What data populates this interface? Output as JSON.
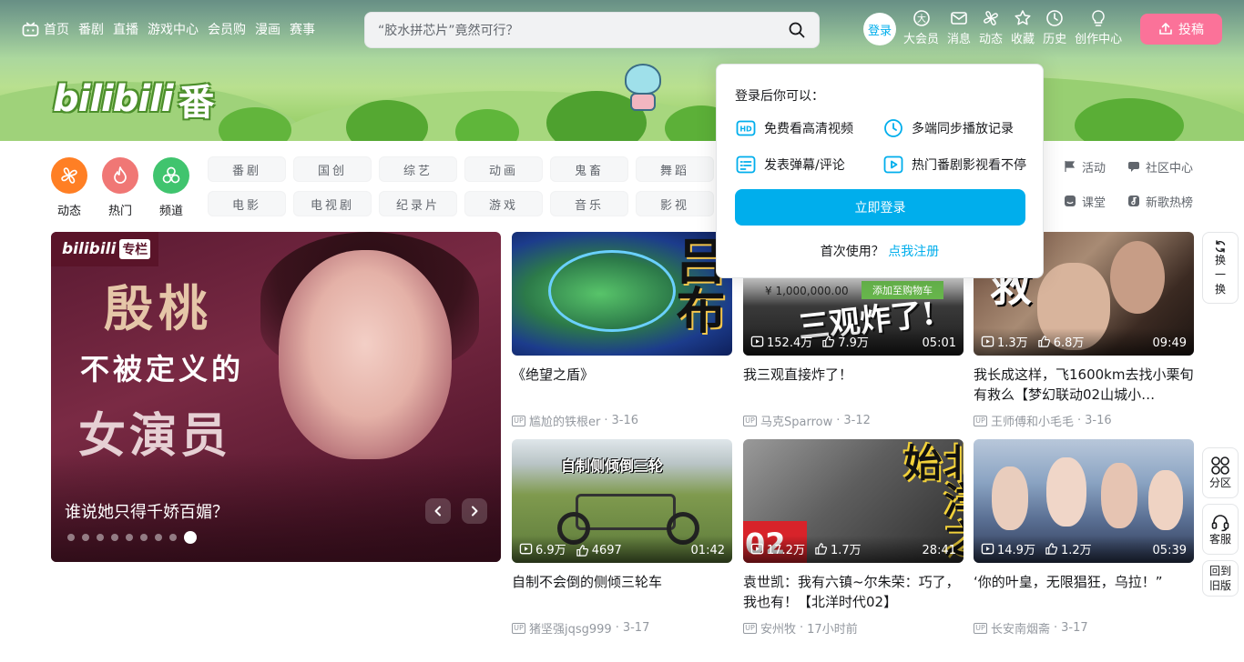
{
  "nav": {
    "left": [
      "首页",
      "番剧",
      "直播",
      "游戏中心",
      "会员购",
      "漫画",
      "赛事"
    ],
    "search_placeholder": "“胶水拼芯片”竟然可行？",
    "login": "登录",
    "right": [
      "大会员",
      "消息",
      "动态",
      "收藏",
      "历史",
      "创作中心"
    ],
    "upload": "投稿"
  },
  "banner": {
    "logo_text": "bilibili",
    "logo_suffix": "番"
  },
  "channels": {
    "big": [
      "动态",
      "热门",
      "频道"
    ],
    "grid": [
      "番剧",
      "国创",
      "综艺",
      "动画",
      "鬼畜",
      "舞蹈",
      "电影",
      "电视剧",
      "纪录片",
      "游戏",
      "音乐",
      "影视"
    ],
    "right": [
      "活动",
      "社区中心",
      "课堂",
      "新歌热榜"
    ]
  },
  "carousel": {
    "badge_logo": "bilibili",
    "badge_label": "专栏",
    "headline_1": "殷桃",
    "headline_2": "不被定义的",
    "headline_3": "女演员",
    "caption": "谁说她只得千娇百媚？",
    "dots": 9,
    "active_dot": 9
  },
  "videos": [
    {
      "title": "《绝望之盾》",
      "author": "尴尬的铁根er",
      "date": "3-16",
      "views": "",
      "likes": "",
      "duration": "",
      "overlay": "吕布"
    },
    {
      "title": "我三观直接炸了！",
      "author": "马克Sparrow",
      "date": "3-12",
      "views": "152.4万",
      "likes": "7.9万",
      "duration": "05:01",
      "overlay": "三观炸了!"
    },
    {
      "title": "我长成这样，飞1600km去找小栗旬有救么【梦幻联动02山城小…",
      "author": "王师傅和小毛毛",
      "date": "3-16",
      "views": "1.3万",
      "likes": "6.8万",
      "duration": "09:49",
      "overlay": "救"
    },
    {
      "title": "自制不会倒的侧倾三轮车",
      "author": "猪坚强jqsg999",
      "date": "3-17",
      "views": "6.9万",
      "likes": "4697",
      "duration": "01:42",
      "overlay": "自制侧倾倒三轮"
    },
    {
      "title": "袁世凯：我有六镇~尔朱荣：巧了，我也有！【北洋时代02】",
      "author": "安州牧",
      "date": "17小时前",
      "views": "17.2万",
      "likes": "1.7万",
      "duration": "28:41",
      "overlay": "北洋之始"
    },
    {
      "title": "‘你的叶皇，无限猖狂，乌拉！”",
      "author": "长安南烟斋",
      "date": "3-17",
      "views": "14.9万",
      "likes": "1.2万",
      "duration": "05:39",
      "overlay": ""
    }
  ],
  "thumb_labels": {
    "price": "¥ 1,000,000.00",
    "cart": "添加至购物车",
    "episode": "02"
  },
  "side": {
    "refresh": [
      "换",
      "一",
      "换"
    ],
    "category": "分区",
    "service": "客服",
    "old_1": "回到",
    "old_2": "旧版"
  },
  "popup": {
    "title": "登录后你可以：",
    "features": [
      "免费看高清视频",
      "多端同步播放记录",
      "发表弹幕/评论",
      "热门番剧影视看不停"
    ],
    "login_button": "立即登录",
    "first_use": "首次使用？",
    "register": "点我注册"
  },
  "colors": {
    "brand_blue": "#00aeec",
    "brand_pink": "#fb7299",
    "dynamic": "#ff7f24",
    "hot": "#f07775",
    "channel": "#40c46e"
  }
}
